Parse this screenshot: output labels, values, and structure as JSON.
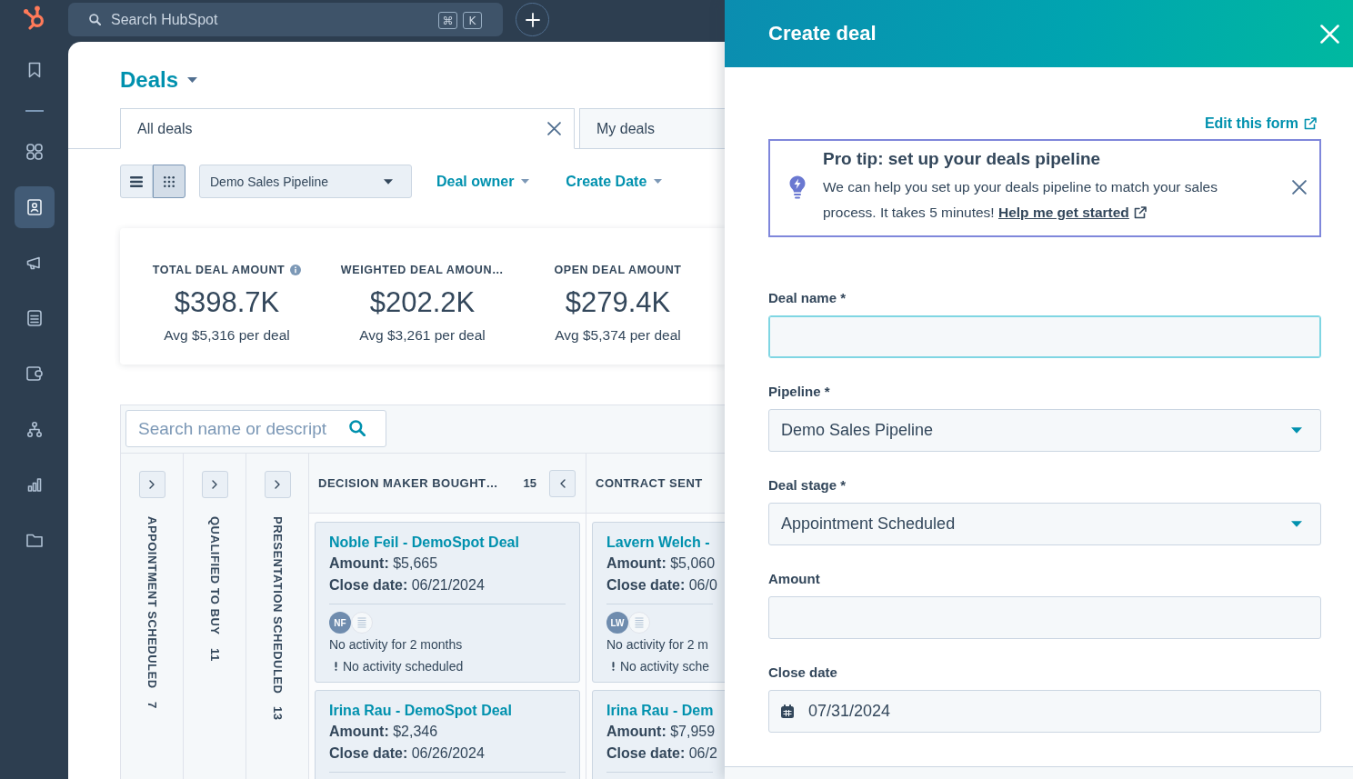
{
  "sidebar": {
    "items": [
      {
        "selected": false
      },
      {
        "selected": false
      },
      {
        "selected": true
      },
      {
        "selected": false
      },
      {
        "selected": false
      },
      {
        "selected": false
      },
      {
        "selected": false
      },
      {
        "selected": false
      },
      {
        "selected": false
      }
    ]
  },
  "top_bar": {
    "search": {
      "placeholder": "Search HubSpot"
    },
    "shortcut": [
      "⌘",
      "K"
    ]
  },
  "page": {
    "title": "Deals",
    "tabs": [
      {
        "label": "All deals",
        "selected": true
      },
      {
        "label": "My deals",
        "selected": false
      }
    ],
    "view_modes": [
      {
        "selected": false
      },
      {
        "selected": true
      }
    ],
    "pipeline": {
      "value": "Demo Sales Pipeline"
    },
    "filters": [
      {
        "label": "Deal owner"
      },
      {
        "label": "Create Date"
      }
    ]
  },
  "stats": [
    {
      "label": "TOTAL DEAL AMOUNT",
      "info": true,
      "value": "$398.7K",
      "average": "Avg $5,316 per deal"
    },
    {
      "label": "WEIGHTED DEAL AMOUN…",
      "info": false,
      "value": "$202.2K",
      "average": "Avg $3,261 per deal"
    },
    {
      "label": "OPEN DEAL AMOUNT",
      "info": false,
      "value": "$279.4K",
      "average": "Avg $5,374 per deal"
    }
  ],
  "board": {
    "search": {
      "placeholder": "Search name or descript"
    },
    "columns": [
      {
        "title": "APPOINTMENT SCHEDULED",
        "count": "7",
        "expanded": false
      },
      {
        "title": "QUALIFIED TO BUY",
        "count": "11",
        "expanded": false
      },
      {
        "title": "PRESENTATION SCHEDULED",
        "count": "13",
        "expanded": false
      },
      {
        "title": "DECISION MAKER BOUGHT…",
        "count": "15",
        "expanded": true,
        "cards": [
          {
            "title": "Noble Feil - DemoSpot Deal",
            "amount": "**Amount:** $5,665",
            "close_date": "**Close date:** 06/21/2024",
            "owner_initials": "NF",
            "last_activity": "No activity for 2 months",
            "next_activity": "No activity scheduled"
          },
          {
            "title": "Irina Rau - DemoSpot Deal",
            "amount": "**Amount:** $2,346",
            "close_date": "**Close date:** 06/26/2024"
          }
        ]
      },
      {
        "title": "CONTRACT SENT",
        "expanded": true,
        "cards": [
          {
            "title": "Lavern Welch -",
            "amount": "**Amount:** $5,060",
            "close_date": "**Close date:** 06/0",
            "owner_initials": "LW",
            "last_activity": "No activity for 2 m",
            "next_activity": "No activity sche"
          },
          {
            "title": "Irina Rau - Dem",
            "amount": "**Amount:** $7,959",
            "close_date": "**Close date:** 06/2"
          }
        ]
      }
    ]
  },
  "panel": {
    "title": "Create deal",
    "edit_link": "Edit this form",
    "tip": {
      "title": "Pro tip: set up your deals pipeline",
      "text": "We can help you set up your deals pipeline to match your sales process. It takes 5 minutes!",
      "link": "Help me get started"
    },
    "fields": [
      {
        "kind": "text",
        "label": "Deal name *",
        "focused": true
      },
      {
        "kind": "select",
        "label": "Pipeline *",
        "value": "Demo Sales Pipeline",
        "focused": false
      },
      {
        "kind": "select",
        "label": "Deal stage *",
        "value": "Appointment Scheduled",
        "focused": false
      },
      {
        "kind": "text",
        "label": "Amount",
        "focused": false
      },
      {
        "kind": "date",
        "label": "Close date",
        "value": "07/31/2024",
        "focused": false
      }
    ]
  }
}
